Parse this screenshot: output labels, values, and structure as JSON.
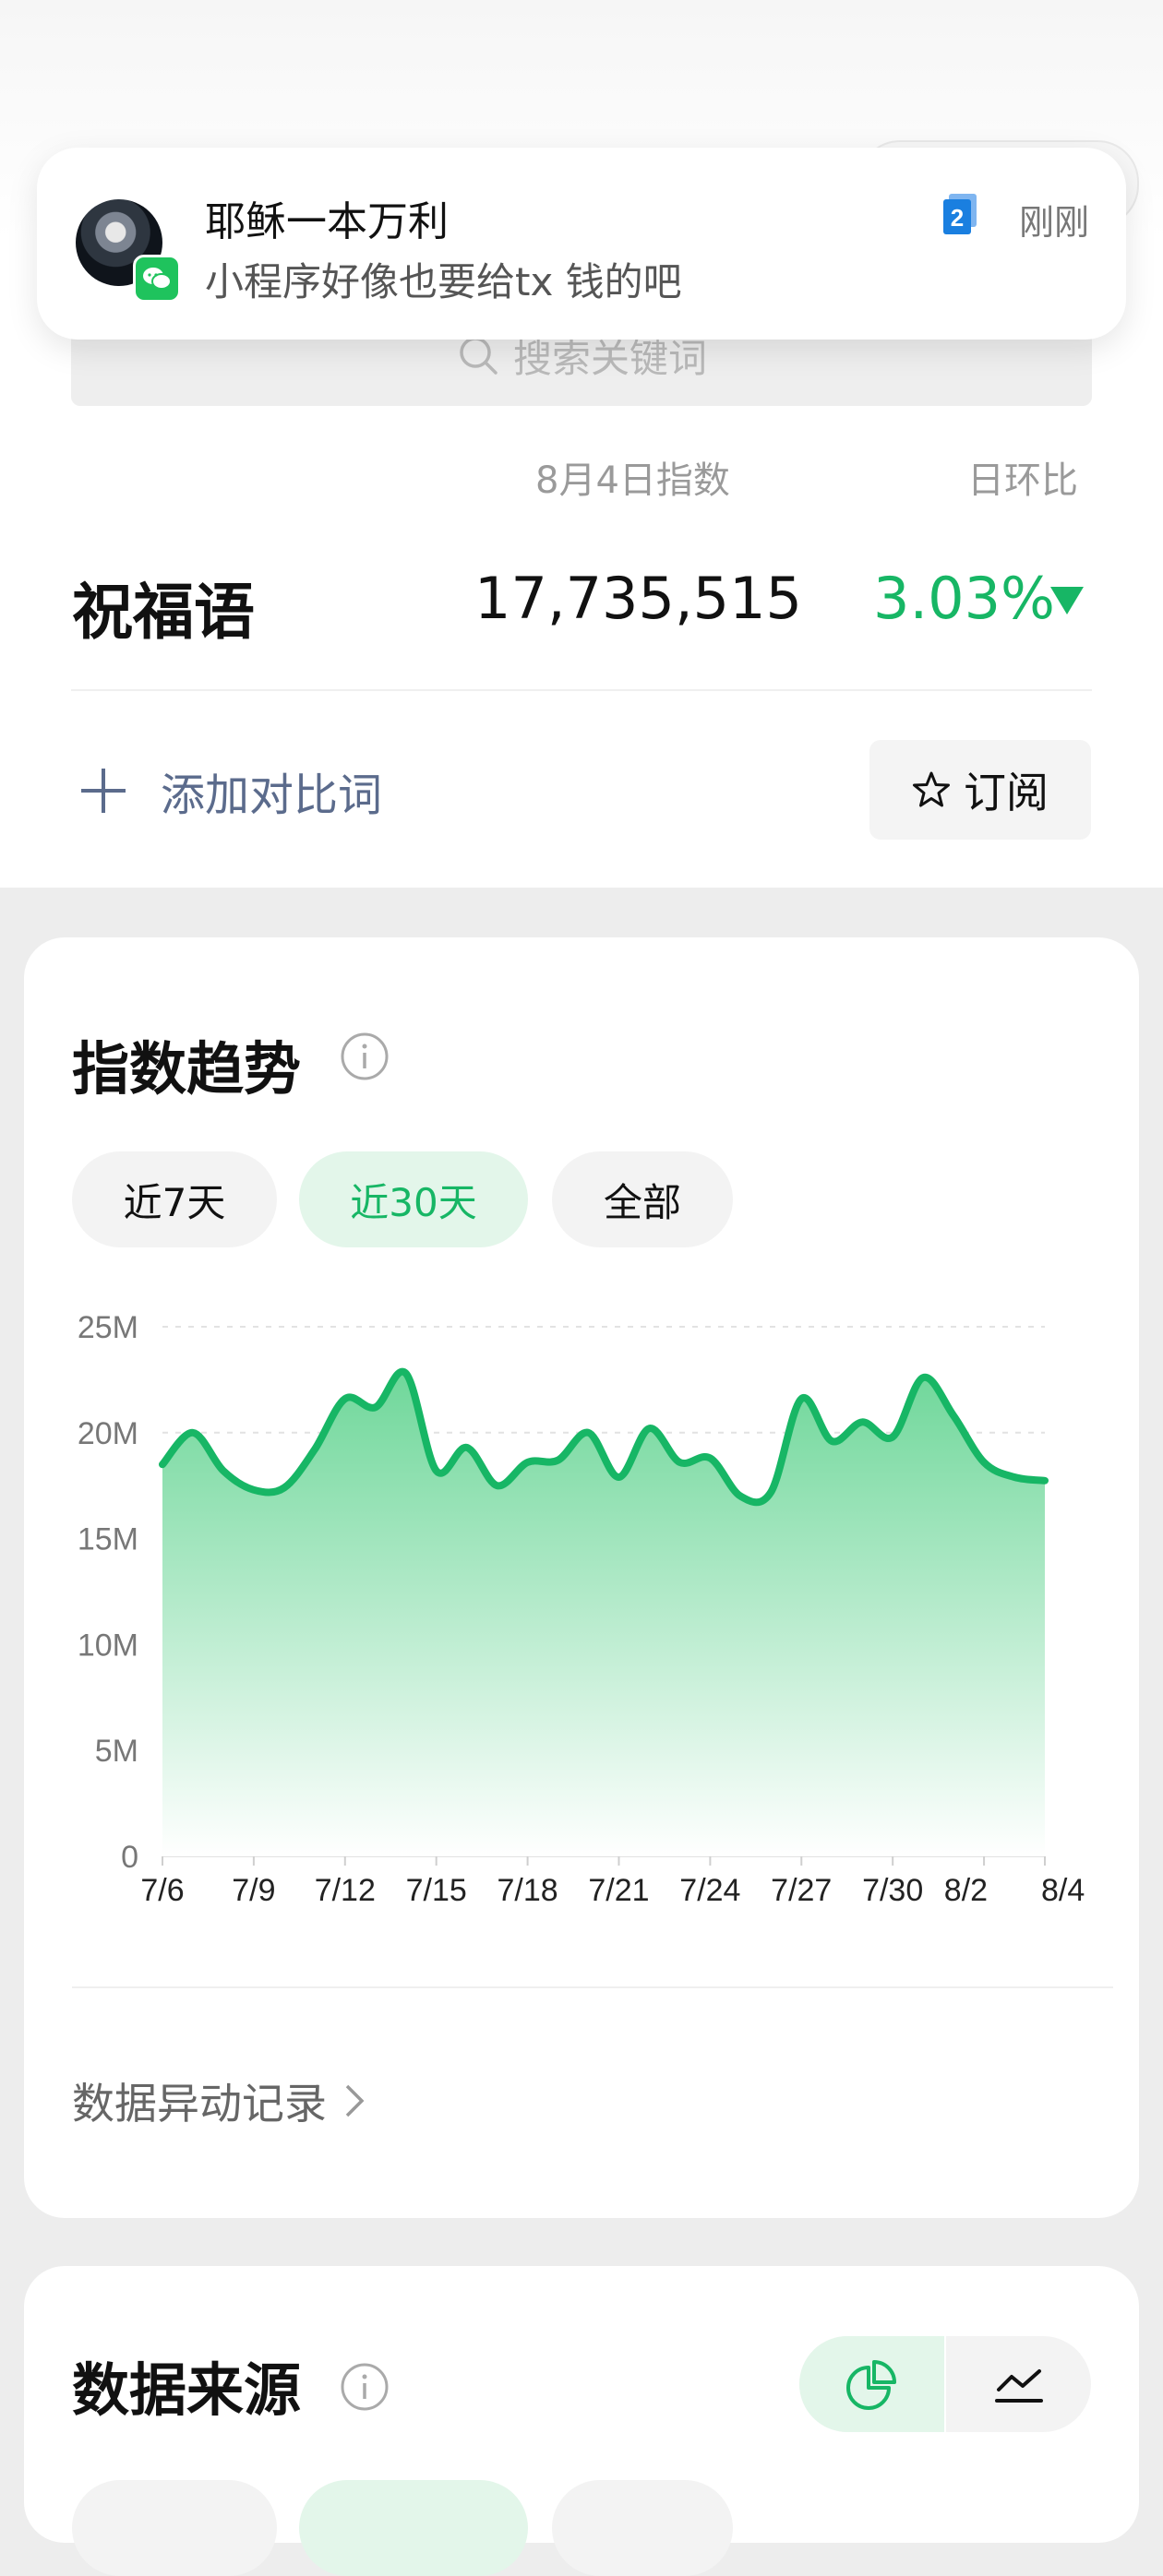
{
  "notification": {
    "sender": "耶稣一本万利",
    "message": "小程序好像也要给tx 钱的吧",
    "count": "2",
    "time": "刚刚",
    "app_icon": "wechat-icon"
  },
  "search": {
    "placeholder": "搜索关键词"
  },
  "summary": {
    "date_label": "8月4日指数",
    "change_label": "日环比",
    "keyword": "祝福语",
    "value": "17,735,515",
    "change": "3.03%",
    "change_direction": "down"
  },
  "actions": {
    "add_compare": "添加对比词",
    "subscribe": "订阅"
  },
  "trend": {
    "title": "指数趋势",
    "tabs": [
      "近7天",
      "近30天",
      "全部"
    ],
    "active_tab": 1,
    "anomaly_link": "数据异动记录"
  },
  "source": {
    "title": "数据来源",
    "view_icons": [
      "pie-chart-icon",
      "line-chart-icon"
    ],
    "active_view": 0
  },
  "colors": {
    "accent": "#17b665",
    "area_top": "#6fd79a",
    "area_bottom": "#ffffff",
    "link_blue": "#5b6b8c"
  },
  "chart_data": {
    "type": "area",
    "title": "",
    "xlabel": "",
    "ylabel": "",
    "ylim": [
      0,
      25000000
    ],
    "yticks": [
      0,
      5000000,
      10000000,
      15000000,
      20000000,
      25000000
    ],
    "ytick_labels": [
      "0",
      "5M",
      "10M",
      "15M",
      "20M",
      "25M"
    ],
    "xtick_labels": [
      "7/6",
      "7/9",
      "7/12",
      "7/15",
      "7/18",
      "7/21",
      "7/24",
      "7/27",
      "7/30",
      "8/2",
      "8/4"
    ],
    "grid": true,
    "x": [
      "7/6",
      "7/7",
      "7/8",
      "7/9",
      "7/10",
      "7/11",
      "7/12",
      "7/13",
      "7/14",
      "7/15",
      "7/16",
      "7/17",
      "7/18",
      "7/19",
      "7/20",
      "7/21",
      "7/22",
      "7/23",
      "7/24",
      "7/25",
      "7/26",
      "7/27",
      "7/28",
      "7/29",
      "7/30",
      "7/31",
      "8/1",
      "8/2",
      "8/3",
      "8/4"
    ],
    "series": [
      {
        "values": [
          18500000,
          20000000,
          18200000,
          17300000,
          17400000,
          19200000,
          21600000,
          21200000,
          22800000,
          18200000,
          19300000,
          17500000,
          18600000,
          18700000,
          20000000,
          17900000,
          20200000,
          18600000,
          18800000,
          17000000,
          17200000,
          21600000,
          19600000,
          20500000,
          19800000,
          22600000,
          20800000,
          18600000,
          17900000,
          17735515
        ]
      }
    ]
  }
}
